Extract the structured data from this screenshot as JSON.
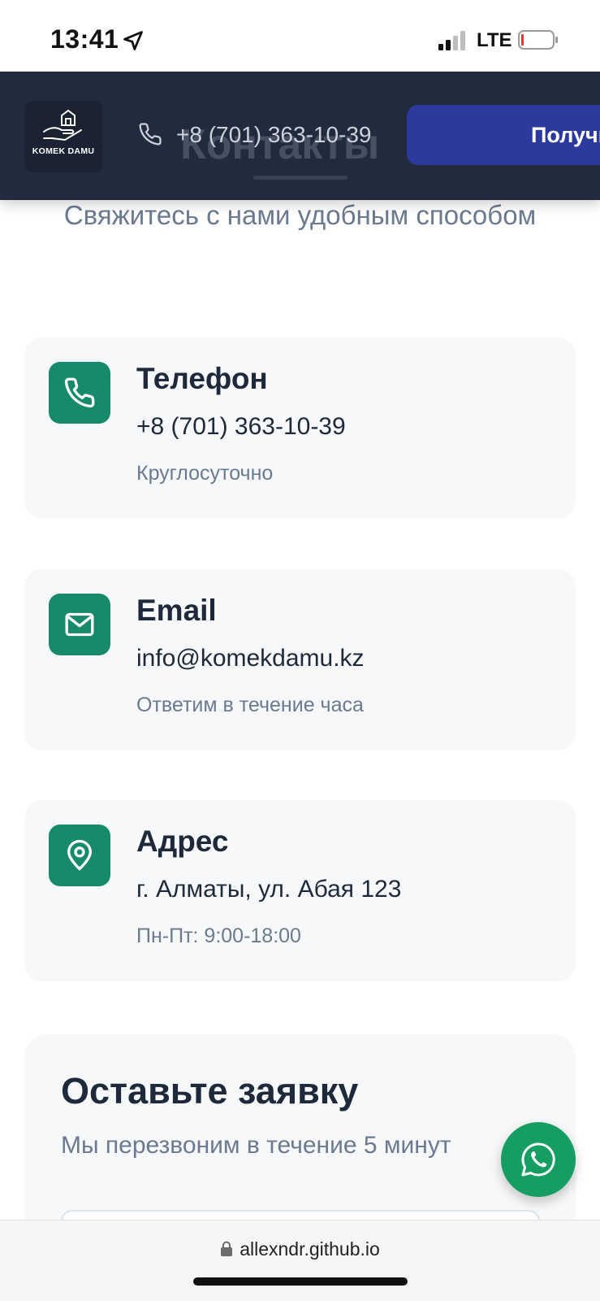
{
  "status_bar": {
    "time": "13:41",
    "network": "LTE",
    "location_icon": "location-arrow-icon",
    "signal_icon": "signal-bars-icon",
    "battery_icon": "battery-low-icon"
  },
  "header": {
    "logo_text": "KOMEK DAMU",
    "logo_icon": "house-in-hand-icon",
    "ghost_title": "Контакты",
    "phone": "+8 (701) 363-10-39",
    "phone_icon": "phone-icon",
    "cta_label": "Получить"
  },
  "main": {
    "subtitle": "Свяжитесь с нами удобным способом",
    "cards": [
      {
        "icon": "phone-icon",
        "title": "Телефон",
        "value": "+8 (701) 363-10-39",
        "note": "Круглосуточно"
      },
      {
        "icon": "mail-icon",
        "title": "Email",
        "value": "info@komekdamu.kz",
        "note": "Ответим в течение часа"
      },
      {
        "icon": "map-pin-icon",
        "title": "Адрес",
        "value": "г. Алматы, ул. Абая 123",
        "note": "Пн-Пт: 9:00-18:00"
      }
    ],
    "form": {
      "title": "Оставьте заявку",
      "subtitle": "Мы перезвоним в течение 5 минут"
    }
  },
  "whatsapp": {
    "icon": "whatsapp-icon"
  },
  "browser": {
    "url": "allexndr.github.io",
    "lock_icon": "lock-icon"
  },
  "colors": {
    "header_bg": "#222b3d",
    "cta_bg": "#2b3a9c",
    "accent_green": "#168a6b",
    "whatsapp_green": "#169d62",
    "card_bg": "#f6f8fa",
    "text_dark": "#1e293b",
    "text_muted": "#6b7a90"
  }
}
